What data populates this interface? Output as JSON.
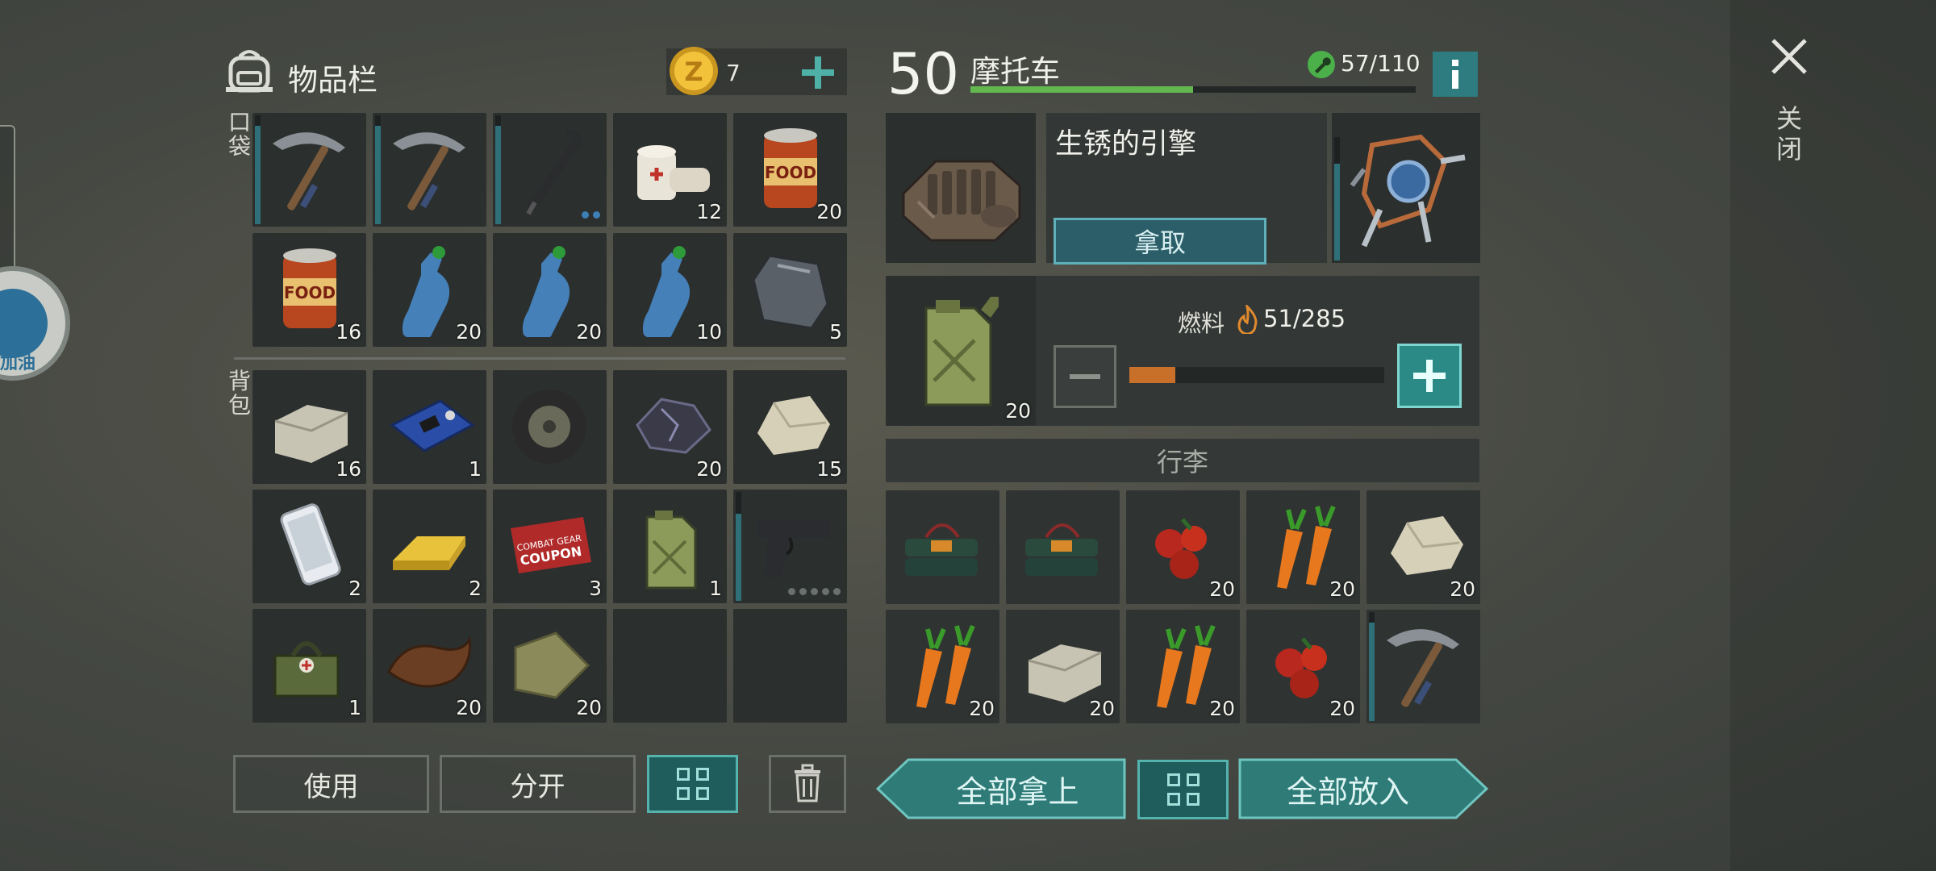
{
  "inventory": {
    "title": "物品栏",
    "coins": "7",
    "pocket_label": "口袋",
    "backpack_label": "背包",
    "pocket": [
      {
        "icon": "pickaxe-icon",
        "count": "",
        "dur": 0.9
      },
      {
        "icon": "pickaxe-icon",
        "count": "",
        "dur": 0.9
      },
      {
        "icon": "crowbar-icon",
        "count": "",
        "dur": 0.9,
        "dots": 2
      },
      {
        "icon": "bandage-icon",
        "count": "12"
      },
      {
        "icon": "canned-food-icon",
        "count": "20"
      },
      {
        "icon": "canned-food-icon",
        "count": "16"
      },
      {
        "icon": "water-bottle-icon",
        "count": "20"
      },
      {
        "icon": "water-bottle-icon",
        "count": "20"
      },
      {
        "icon": "water-bottle-icon",
        "count": "10"
      },
      {
        "icon": "metal-plate-icon",
        "count": "5"
      }
    ],
    "backpack": [
      {
        "icon": "stone-block-icon",
        "count": "16"
      },
      {
        "icon": "circuit-board-icon",
        "count": "1"
      },
      {
        "icon": "wheel-icon",
        "count": ""
      },
      {
        "icon": "coal-ore-icon",
        "count": "20"
      },
      {
        "icon": "rock-icon",
        "count": "15"
      },
      {
        "icon": "smartphone-icon",
        "count": "2"
      },
      {
        "icon": "gold-bar-icon",
        "count": "2"
      },
      {
        "icon": "coupon-icon",
        "count": "3"
      },
      {
        "icon": "jerrycan-icon",
        "count": "1"
      },
      {
        "icon": "pistol-icon",
        "count": "",
        "dur": 0.8,
        "dots": 5
      },
      {
        "icon": "first-aid-bag-icon",
        "count": "1"
      },
      {
        "icon": "leather-icon",
        "count": "20"
      },
      {
        "icon": "cloth-icon",
        "count": "20"
      },
      {
        "icon": "empty",
        "count": ""
      },
      {
        "icon": "empty",
        "count": ""
      }
    ],
    "coupon_text": "COMBAT GEAR\nCOUPON",
    "food_label": "FOOD",
    "buttons": {
      "use": "使用",
      "split": "分开"
    }
  },
  "vehicle": {
    "level": "50",
    "name": "摩托车",
    "durability": "57/110",
    "xp_progress": 0.5,
    "engine": {
      "name": "生锈的引擎",
      "take_label": "拿取"
    },
    "fuel": {
      "label": "燃料",
      "value": "51/285",
      "progress": 0.18,
      "can_count": "20"
    },
    "luggage_label": "行李",
    "luggage": [
      {
        "icon": "c4-explosive-icon",
        "count": ""
      },
      {
        "icon": "c4-explosive-icon",
        "count": ""
      },
      {
        "icon": "berries-icon",
        "count": "20"
      },
      {
        "icon": "carrot-icon",
        "count": "20"
      },
      {
        "icon": "rock-icon",
        "count": "20"
      },
      {
        "icon": "carrot-icon",
        "count": "20"
      },
      {
        "icon": "stone-block-icon",
        "count": "20"
      },
      {
        "icon": "carrot-icon",
        "count": "20"
      },
      {
        "icon": "berries-icon",
        "count": "20"
      },
      {
        "icon": "pickaxe-icon",
        "count": "",
        "dur": 0.9
      }
    ],
    "buttons": {
      "take_all": "全部拿上",
      "put_all": "全部放入"
    }
  },
  "close_label": "关闭",
  "side_label": "加油",
  "colors": {
    "accent": "#55b3ae",
    "xp_bar": "#62b84e",
    "fuel_bar": "#c8702a",
    "panel": "#2b2f2e"
  }
}
